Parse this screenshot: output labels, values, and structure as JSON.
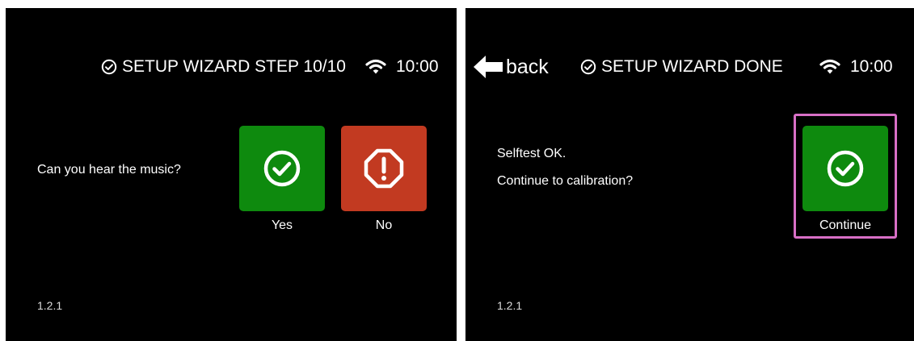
{
  "screens": [
    {
      "header": {
        "title": "SETUP WIZARD STEP 10/10",
        "time": "10:00"
      },
      "question": "Can you hear the music?",
      "buttons": [
        {
          "label": "Yes",
          "icon": "check-circle-icon",
          "color": "#0e8a0e"
        },
        {
          "label": "No",
          "icon": "stop-warning-icon",
          "color": "#c23a21"
        }
      ],
      "version": "1.2.1"
    },
    {
      "header": {
        "back_label": "back",
        "title": "SETUP WIZARD DONE",
        "time": "10:00"
      },
      "message_lines": [
        "Selftest OK.",
        "Continue to calibration?"
      ],
      "buttons": [
        {
          "label": "Continue",
          "icon": "check-circle-icon",
          "color": "#0e8a0e"
        }
      ],
      "highlight_color": "#d86fc6",
      "version": "1.2.1"
    }
  ]
}
